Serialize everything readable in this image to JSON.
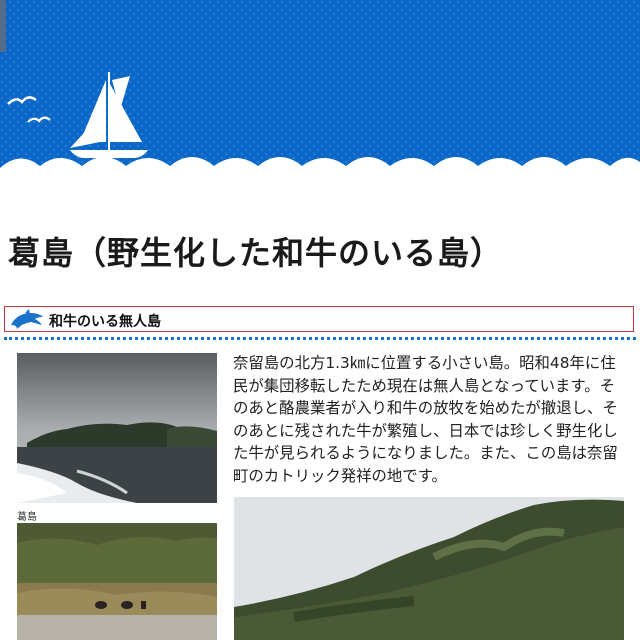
{
  "page": {
    "title": "葛島（野生化した和牛のいる島）"
  },
  "section": {
    "heading": "和牛のいる無人島",
    "icon": "dolphin-icon"
  },
  "body": {
    "paragraph": "奈留島の北方1.3㎞に位置する小さい島。昭和48年に住民が集団移転したため現在は無人島となっています。そのあと酪農業者が入り和牛の放牧を始めたが撤退し、そのあとに残された牛が繁殖し、日本では珍しく野生化した牛が見られるようになりました。また、この島は奈留町のカトリック発祥の地です。"
  },
  "photos": {
    "island_caption": "葛島"
  },
  "colors": {
    "header_blue": "#0a67c8",
    "accent_red": "#c0393b",
    "rule_blue": "#1a73c9"
  }
}
